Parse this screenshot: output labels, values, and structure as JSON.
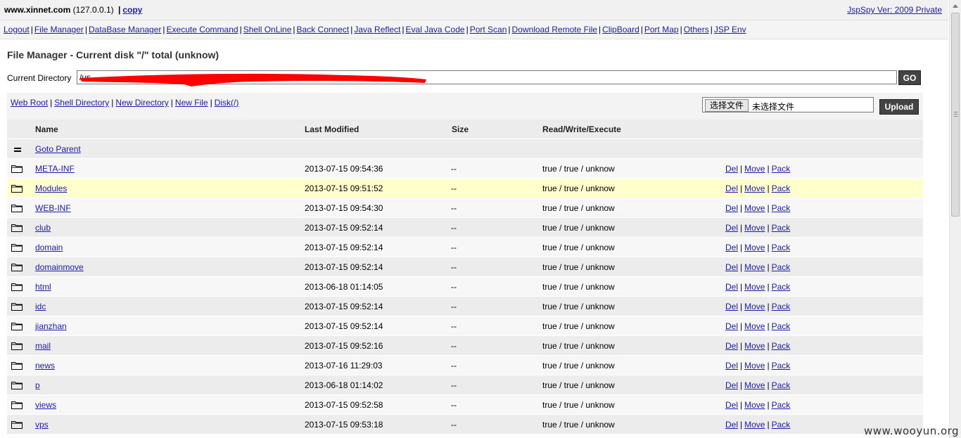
{
  "header": {
    "host": "www.xinnet.com",
    "ip": "(127.0.0.1)",
    "copy_label": "copy",
    "version": "JspSpy Ver: 2009 Private"
  },
  "nav": [
    "Logout",
    "File Manager",
    "DataBase Manager",
    "Execute Command",
    "Shell OnLine",
    "Back Connect",
    "Java Reflect",
    "Eval Java Code",
    "Port Scan",
    "Download Remote File",
    "ClipBoard",
    "Port Map",
    "Others",
    "JSP Env"
  ],
  "page_title": "File Manager - Current disk \"/\" total (unknow)",
  "current_directory": {
    "label": "Current Directory",
    "value": "/us",
    "go_label": "GO"
  },
  "toolbar": {
    "links": [
      "Web Root",
      "Shell Directory",
      "New Directory",
      "New File",
      "Disk(/)"
    ],
    "file_button": "选择文件",
    "file_status": "未选择文件",
    "upload_label": "Upload"
  },
  "table": {
    "columns": [
      "Name",
      "Last Modified",
      "Size",
      "Read/Write/Execute"
    ],
    "parent_label": "Goto Parent",
    "actions": [
      "Del",
      "Move",
      "Pack"
    ],
    "rows": [
      {
        "name": "META-INF",
        "modified": "2013-07-15 09:54:36",
        "size": "--",
        "rwx": "true / true / unknow"
      },
      {
        "name": "Modules",
        "modified": "2013-07-15 09:51:52",
        "size": "--",
        "rwx": "true / true / unknow"
      },
      {
        "name": "WEB-INF",
        "modified": "2013-07-15 09:54:30",
        "size": "--",
        "rwx": "true / true / unknow"
      },
      {
        "name": "club",
        "modified": "2013-07-15 09:52:14",
        "size": "--",
        "rwx": "true / true / unknow"
      },
      {
        "name": "domain",
        "modified": "2013-07-15 09:52:14",
        "size": "--",
        "rwx": "true / true / unknow"
      },
      {
        "name": "domainmove",
        "modified": "2013-07-15 09:52:14",
        "size": "--",
        "rwx": "true / true / unknow"
      },
      {
        "name": "html",
        "modified": "2013-06-18 01:14:05",
        "size": "--",
        "rwx": "true / true / unknow"
      },
      {
        "name": "idc",
        "modified": "2013-07-15 09:52:14",
        "size": "--",
        "rwx": "true / true / unknow"
      },
      {
        "name": "jianzhan",
        "modified": "2013-07-15 09:52:14",
        "size": "--",
        "rwx": "true / true / unknow"
      },
      {
        "name": "mail",
        "modified": "2013-07-15 09:52:16",
        "size": "--",
        "rwx": "true / true / unknow"
      },
      {
        "name": "news",
        "modified": "2013-07-16 11:29:03",
        "size": "--",
        "rwx": "true / true / unknow"
      },
      {
        "name": "p",
        "modified": "2013-06-18 01:14:02",
        "size": "--",
        "rwx": "true / true / unknow"
      },
      {
        "name": "views",
        "modified": "2013-07-15 09:52:58",
        "size": "--",
        "rwx": "true / true / unknow"
      },
      {
        "name": "vps",
        "modified": "2013-07-15 09:53:18",
        "size": "--",
        "rwx": "true / true / unknow"
      }
    ]
  },
  "watermark": "www.wooyun.org",
  "colors": {
    "link": "#1b1bb0",
    "button_bg": "#444444",
    "highlight_row": "#ffffcc",
    "redaction": "#ff0000"
  }
}
